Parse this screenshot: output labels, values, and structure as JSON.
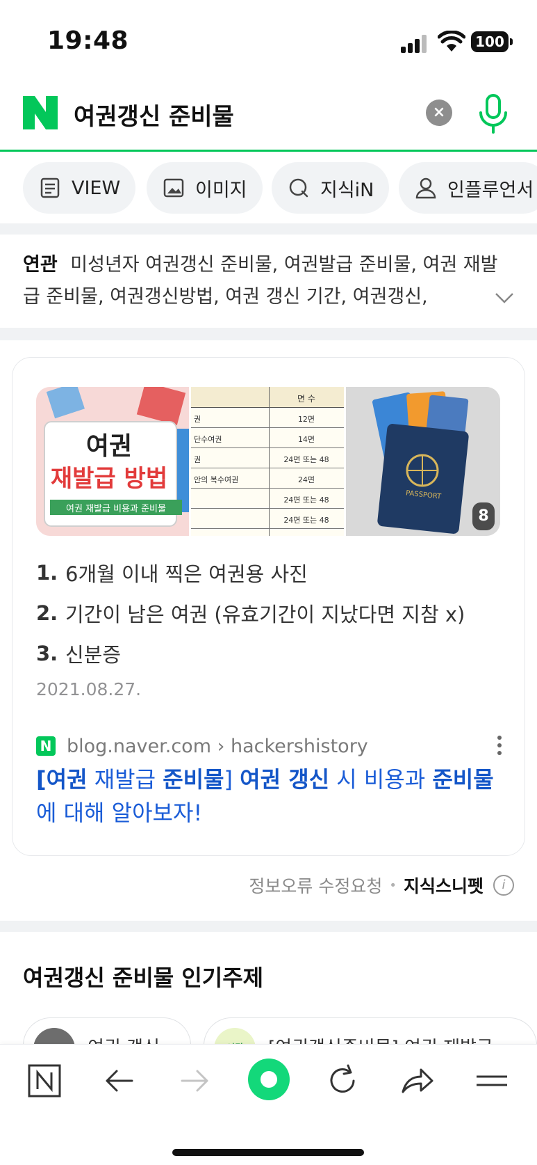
{
  "status_bar": {
    "time": "19:48",
    "battery": "100"
  },
  "search": {
    "query": "여권갱신 준비물",
    "clear_label": "×"
  },
  "tabs": [
    {
      "label": "VIEW",
      "icon": "document-icon"
    },
    {
      "label": "이미지",
      "icon": "image-icon"
    },
    {
      "label": "지식iN",
      "icon": "q-icon"
    },
    {
      "label": "인플루언서",
      "icon": "person-icon"
    }
  ],
  "related": {
    "label": "연관",
    "text": "미성년자 여권갱신 준비물, 여권발급 준비물, 여권 재발급 준비물, 여권갱신방법, 여권 갱신 기간, 여권갱신,"
  },
  "snippet": {
    "thumbnails": {
      "t1_title": "여권",
      "t1_sub": "재발급 방법",
      "t1_caption": "여권 재발급 비용과 준비물",
      "t2_header": "면 수",
      "t2_rows": [
        {
          "left": "권",
          "right": "12면"
        },
        {
          "left": "단수여권",
          "right": "14면"
        },
        {
          "left": "권",
          "right": "24면 또는 48"
        },
        {
          "left": "안의 복수여권",
          "right": "24면"
        },
        {
          "left": "",
          "right": "24면 또는 48"
        },
        {
          "left": "",
          "right": "24면 또는 48"
        }
      ],
      "t3_passport": "PASSPORT",
      "count": "8"
    },
    "items": [
      {
        "num": "1.",
        "text": "6개월 이내 찍은 여권용 사진"
      },
      {
        "num": "2.",
        "text": "기간이 남은 여권 (유효기간이 지났다면 지참 x)"
      },
      {
        "num": "3.",
        "text": "신분증"
      }
    ],
    "date": "2021.08.27.",
    "source": {
      "favicon": "N",
      "url": "blog.naver.com › hackershistory"
    },
    "title_parts": [
      {
        "t": "[",
        "b": true
      },
      {
        "t": "여권",
        "b": true
      },
      {
        "t": " 재발급 ",
        "b": false
      },
      {
        "t": "준비물",
        "b": true
      },
      {
        "t": "] ",
        "b": false
      },
      {
        "t": "여권 갱신",
        "b": true
      },
      {
        "t": " 시 비용과 ",
        "b": false
      },
      {
        "t": "준비물",
        "b": true
      },
      {
        "t": "에 대해 알아보자!",
        "b": false
      }
    ]
  },
  "report": {
    "label": "정보오류 수정요청",
    "separator": "•",
    "brand": "지식스니펫",
    "info_icon": "i"
  },
  "popular": {
    "title": "여권갱신 준비물 인기주제",
    "chips": [
      {
        "label": "여권 갱신"
      },
      {
        "label": "[여권갱신준비물] 여권 재발급",
        "avatar_text": "여권"
      }
    ]
  },
  "toolbar": [
    "naver-home-icon",
    "back-arrow-icon",
    "forward-arrow-icon",
    "green-dot-icon",
    "refresh-icon",
    "share-icon",
    "menu-icon"
  ],
  "colors": {
    "naver_green": "#03c75a",
    "link_blue": "#1a5cd7"
  }
}
